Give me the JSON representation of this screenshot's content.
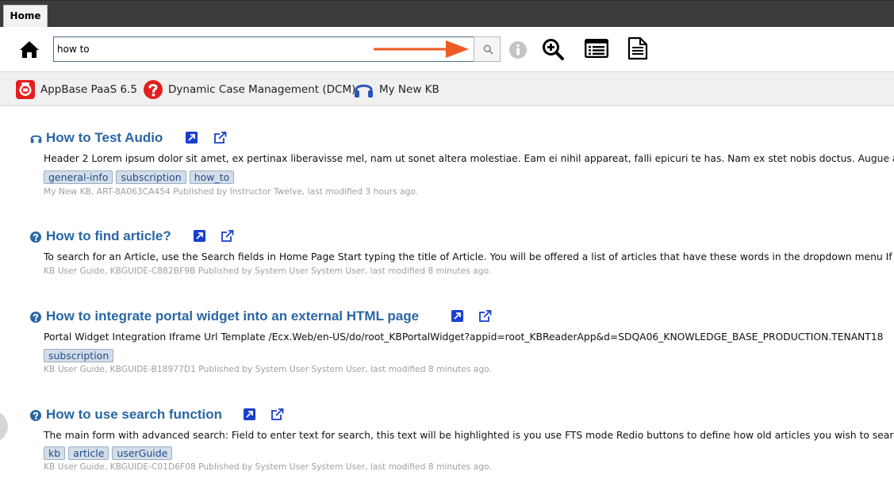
{
  "tabs": [
    {
      "label": "Home"
    }
  ],
  "search": {
    "value": "how to",
    "placeholder": ""
  },
  "knowledge_bases": [
    {
      "label": "AppBase PaaS 6.5",
      "icon": "appbase-icon"
    },
    {
      "label": "Dynamic Case Management (DCM)",
      "icon": "question-circle-icon"
    },
    {
      "label": "My New KB",
      "icon": "headphones-icon"
    }
  ],
  "colors": {
    "title_blue": "#2a66a4",
    "tag_bg": "#d4dde8",
    "arrow": "#ee5a24",
    "kb_red": "#e51e1e",
    "kb_blue": "#2a55b8",
    "toolbar_bg": "#3c3c3c"
  },
  "results": [
    {
      "type_icon": "headphones-icon",
      "title": "How to Test Audio",
      "snippet": "Header 2 Lorem ipsum dolor sit amet, ex pertinax liberavisse mel, nam ut sonet altera molestiae. Eam ei nihil appareat, falli epicuri te has. Nam ex stet nobis doctus. Augue ancillae",
      "tags": [
        "general-info",
        "subscription",
        "how_to"
      ],
      "meta": "My New KB, ART-8A063CA454 Published by Instructor Twelve, last modified 3 hours ago."
    },
    {
      "type_icon": "question-circle-icon",
      "title": "How to find article?",
      "snippet": "To search for an Article, use the Search fields in Home Page Start typing the title of Article. You will be offered a list of articles that have these words in the dropdown menu If the",
      "tags": [],
      "meta": "KB User Guide, KBGUIDE-C882BF9B Published by System User System User, last modified 8 minutes ago."
    },
    {
      "type_icon": "question-circle-icon",
      "title": "How to integrate portal widget into an external HTML page",
      "snippet": "Portal Widget Integration Iframe Url Template /Ecx.Web/en-US/do/root_KBPortalWidget?appid=root_KBReaderApp&d=SDQA06_KNOWLEDGE_BASE_PRODUCTION.TENANT18",
      "tags": [
        "subscription"
      ],
      "meta": "KB User Guide, KBGUIDE-B18977D1 Published by System User System User, last modified 8 minutes ago."
    },
    {
      "type_icon": "question-circle-icon",
      "title": "How to use search function",
      "snippet": "The main form with advanced search: Field to enter text for search, this text will be highlighted is you use FTS mode Redio buttons to define how old articles you wish to search",
      "tags": [
        "kb",
        "article",
        "userGuide"
      ],
      "meta": "KB User Guide, KBGUIDE-C01D6F08 Published by System User System User, last modified 8 minutes ago."
    }
  ]
}
